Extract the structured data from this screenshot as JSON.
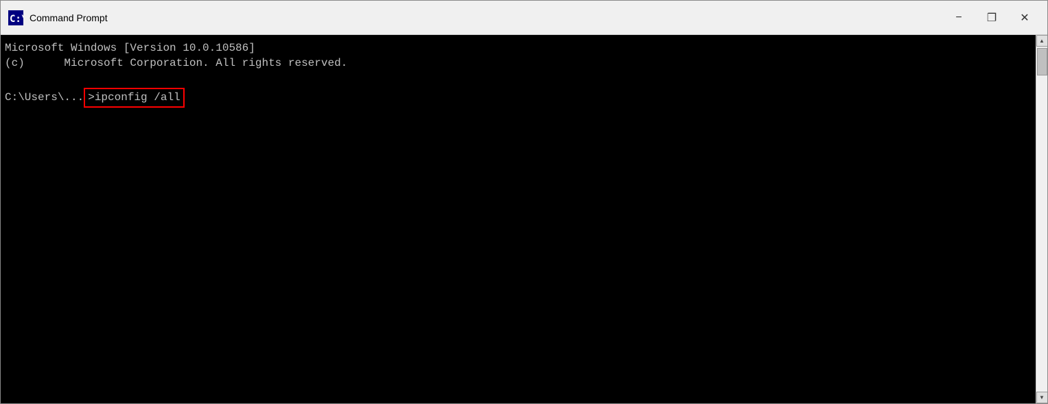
{
  "titlebar": {
    "title": "Command Prompt",
    "icon": "cmd-icon",
    "minimize_label": "−",
    "maximize_label": "❐",
    "close_label": "✕"
  },
  "terminal": {
    "lines": [
      "Microsoft Windows [Version 10.0.10586]",
      "(c)      Microsoft Corporation. All rights reserved.",
      "",
      "C:\\Users\\..._"
    ],
    "prompt": "C:\\Users\\..._",
    "prompt_prefix": "C:\\Users\\...",
    "command": ">ipconfig /all"
  }
}
